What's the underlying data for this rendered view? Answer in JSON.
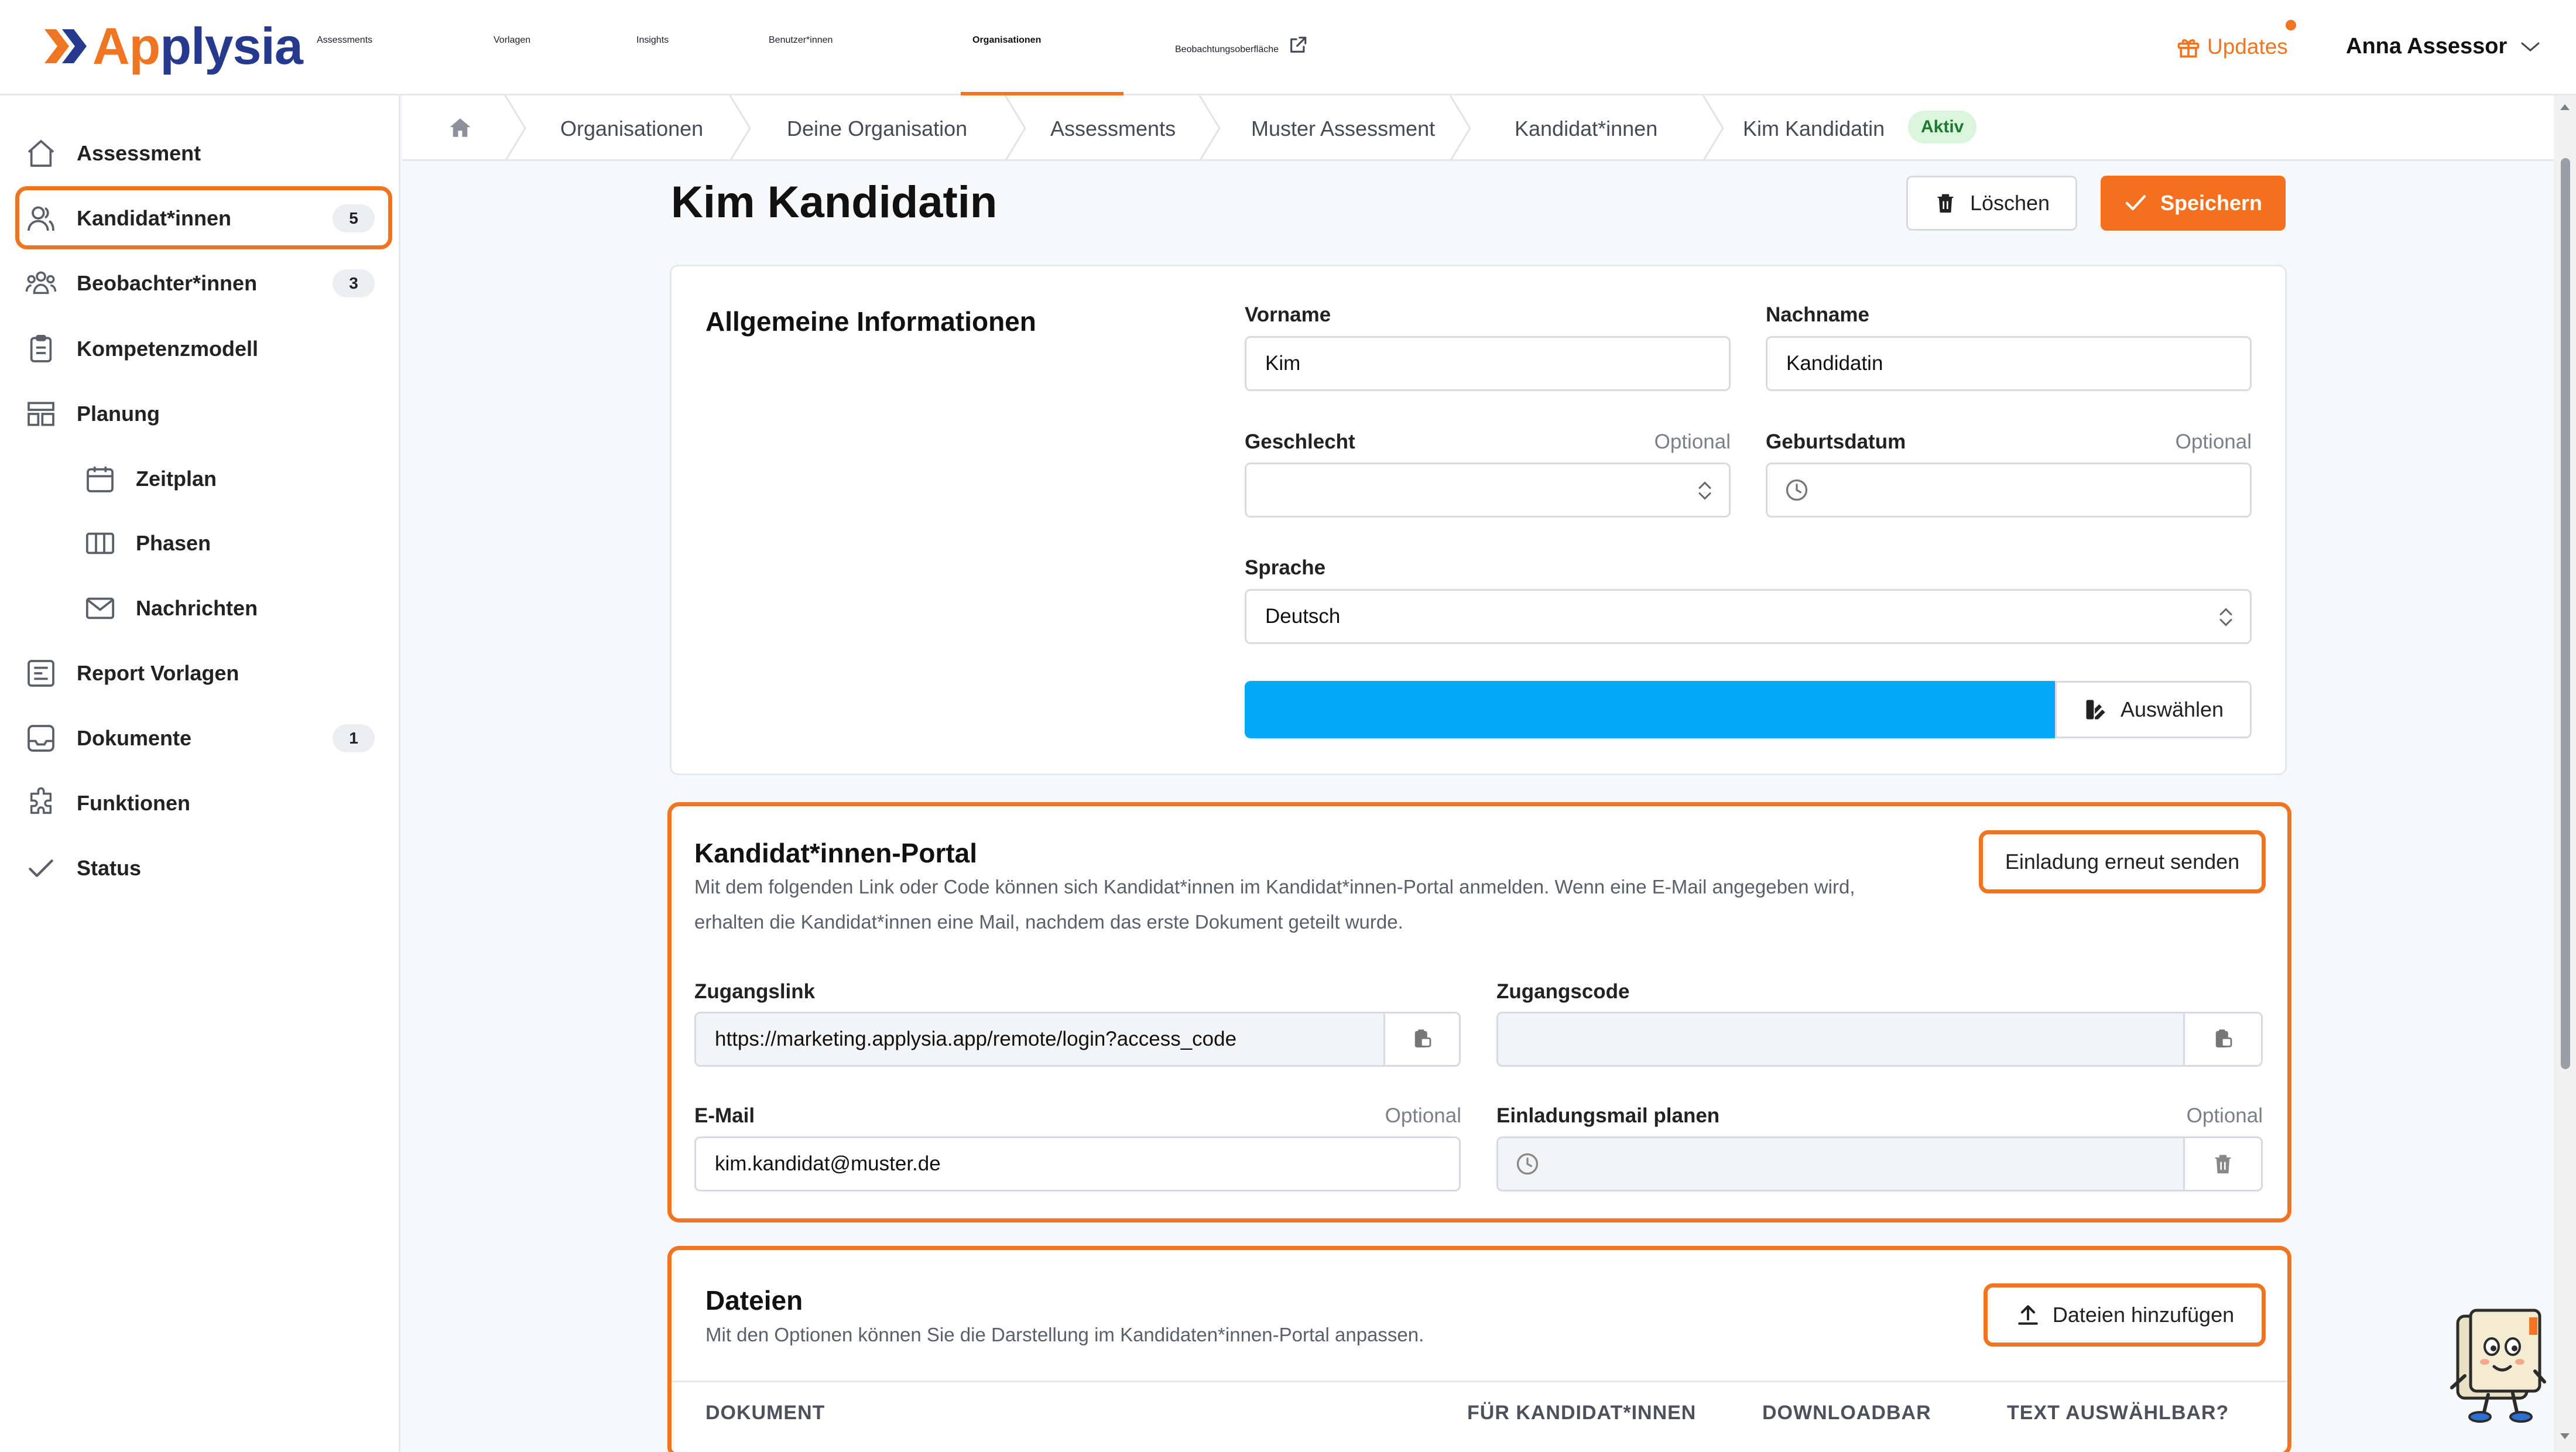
{
  "brand": {
    "logo_text_a": "Ap",
    "logo_text_b": "plysia",
    "accent": "#f07522",
    "brand_blue": "#253a8c"
  },
  "topnav": {
    "items": [
      "Assessments",
      "Vorlagen",
      "Insights",
      "Benutzer*innen",
      "Organisationen",
      "Beobachtungsoberfläche"
    ],
    "active": "Organisationen",
    "updates_label": "Updates",
    "user_name": "Anna Assessor"
  },
  "sidebar": {
    "items": [
      {
        "label": "Assessment",
        "icon": "home-icon"
      },
      {
        "label": "Kandidat*innen",
        "icon": "users-icon",
        "count": "5",
        "selected": true
      },
      {
        "label": "Beobachter*innen",
        "icon": "group-icon",
        "count": "3"
      },
      {
        "label": "Kompetenzmodell",
        "icon": "clipboard-icon"
      },
      {
        "label": "Planung",
        "icon": "layout-icon"
      },
      {
        "label": "Zeitplan",
        "icon": "calendar-icon",
        "sub": true
      },
      {
        "label": "Phasen",
        "icon": "columns-icon",
        "sub": true
      },
      {
        "label": "Nachrichten",
        "icon": "mail-icon",
        "sub": true
      },
      {
        "label": "Report Vorlagen",
        "icon": "report-icon"
      },
      {
        "label": "Dokumente",
        "icon": "inbox-icon",
        "count": "1"
      },
      {
        "label": "Funktionen",
        "icon": "puzzle-icon"
      },
      {
        "label": "Status",
        "icon": "check-icon"
      }
    ]
  },
  "breadcrumb": {
    "items": [
      "Organisationen",
      "Deine Organisation",
      "Assessments",
      "Muster Assessment",
      "Kandidat*innen",
      "Kim Kandidatin"
    ],
    "status_badge": "Aktiv"
  },
  "page": {
    "title": "Kim Kandidatin",
    "delete_label": "Löschen",
    "save_label": "Speichern"
  },
  "general": {
    "title": "Allgemeine Informationen",
    "firstname_label": "Vorname",
    "firstname_value": "Kim",
    "lastname_label": "Nachname",
    "lastname_value": "Kandidatin",
    "gender_label": "Geschlecht",
    "gender_optional": "Optional",
    "gender_value": "",
    "birthdate_label": "Geburtsdatum",
    "birthdate_optional": "Optional",
    "birthdate_value": "",
    "language_label": "Sprache",
    "language_value": "Deutsch",
    "color_value": "#03a9f4",
    "choose_label": "Auswählen"
  },
  "portal": {
    "title": "Kandidat*innen-Portal",
    "desc_line1": "Mit dem folgenden Link oder Code können sich Kandidat*innen im Kandidat*innen-Portal anmelden. Wenn eine E-Mail angegeben wird,",
    "desc_line2": "erhalten die Kandidat*innen eine Mail, nachdem das erste Dokument geteilt wurde.",
    "resend_label": "Einladung erneut senden",
    "link_label": "Zugangslink",
    "link_value": "https://marketing.applysia.app/remote/login?access_code",
    "code_label": "Zugangscode",
    "code_value": "",
    "email_label": "E-Mail",
    "email_optional": "Optional",
    "email_value": "kim.kandidat@muster.de",
    "schedule_label": "Einladungsmail planen",
    "schedule_optional": "Optional",
    "schedule_value": ""
  },
  "files": {
    "title": "Dateien",
    "desc": "Mit den Optionen können Sie die Darstellung im Kandidaten*innen-Portal anpassen.",
    "add_label": "Dateien hinzufügen",
    "columns": [
      "DOKUMENT",
      "FÜR KANDIDAT*INNEN",
      "DOWNLOADBAR",
      "TEXT AUSWÄHLBAR?"
    ]
  }
}
